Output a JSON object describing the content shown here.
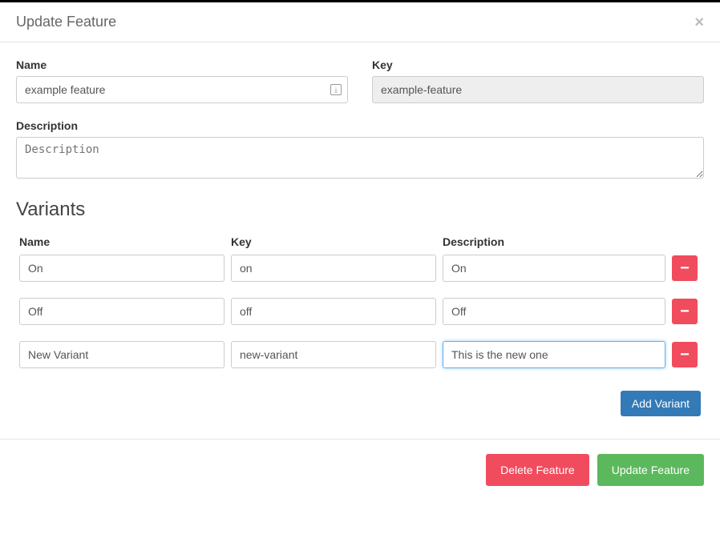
{
  "modal": {
    "title": "Update Feature",
    "name_label": "Name",
    "name_value": "example feature",
    "key_label": "Key",
    "key_value": "example-feature",
    "description_label": "Description",
    "description_placeholder": "Description",
    "description_value": ""
  },
  "variants": {
    "heading": "Variants",
    "columns": {
      "name": "Name",
      "key": "Key",
      "description": "Description"
    },
    "rows": [
      {
        "name": "On",
        "key": "on",
        "description": "On",
        "focused": false
      },
      {
        "name": "Off",
        "key": "off",
        "description": "Off",
        "focused": false
      },
      {
        "name": "New Variant",
        "key": "new-variant",
        "description": "This is the new one",
        "focused": true
      }
    ],
    "add_label": "Add Variant"
  },
  "footer": {
    "delete_label": "Delete Feature",
    "update_label": "Update Feature"
  }
}
